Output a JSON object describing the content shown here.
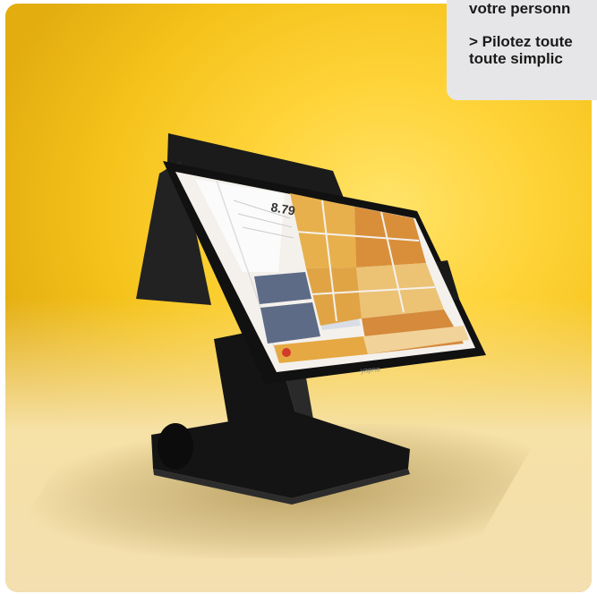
{
  "info_box": {
    "line_1": "votre personn",
    "line_2": "> Pilotez toute",
    "line_3": "toute simplic"
  },
  "terminal": {
    "brand_text": "yapna",
    "screen_display_value": "8.79"
  },
  "colors": {
    "background": "#ffd43a",
    "device": "#161616",
    "info_box": "#e6e6e8"
  }
}
